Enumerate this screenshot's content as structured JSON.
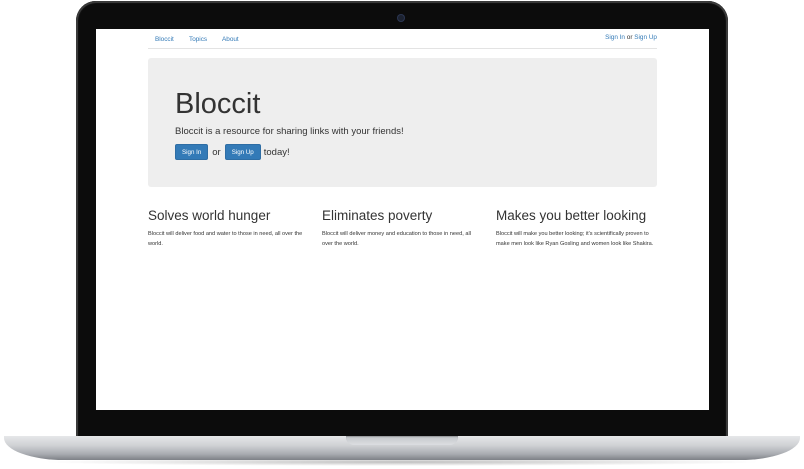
{
  "nav": {
    "brand": "Bloccit",
    "topics": "Topics",
    "about": "About",
    "sign_in": "Sign In",
    "or": "or",
    "sign_up": "Sign Up"
  },
  "hero": {
    "title": "Bloccit",
    "lead": "Bloccit is a resource for sharing links with your friends!",
    "sign_in_button": "Sign In",
    "or": "or",
    "sign_up_button": "Sign Up",
    "suffix": "today!"
  },
  "features": [
    {
      "title": "Solves world hunger",
      "text": "Bloccit will deliver food and water to those in need, all over the world."
    },
    {
      "title": "Eliminates poverty",
      "text": "Bloccit will deliver money and education to those in need, all over the world."
    },
    {
      "title": "Makes you better looking",
      "text": "Bloccit will make you better looking; it's scientifically proven to make men look like Ryan Gosling and women look like Shakira."
    }
  ],
  "colors": {
    "link": "#337ab7",
    "button": "#337ab7",
    "jumbotron": "#eeeeee",
    "text": "#333333"
  }
}
